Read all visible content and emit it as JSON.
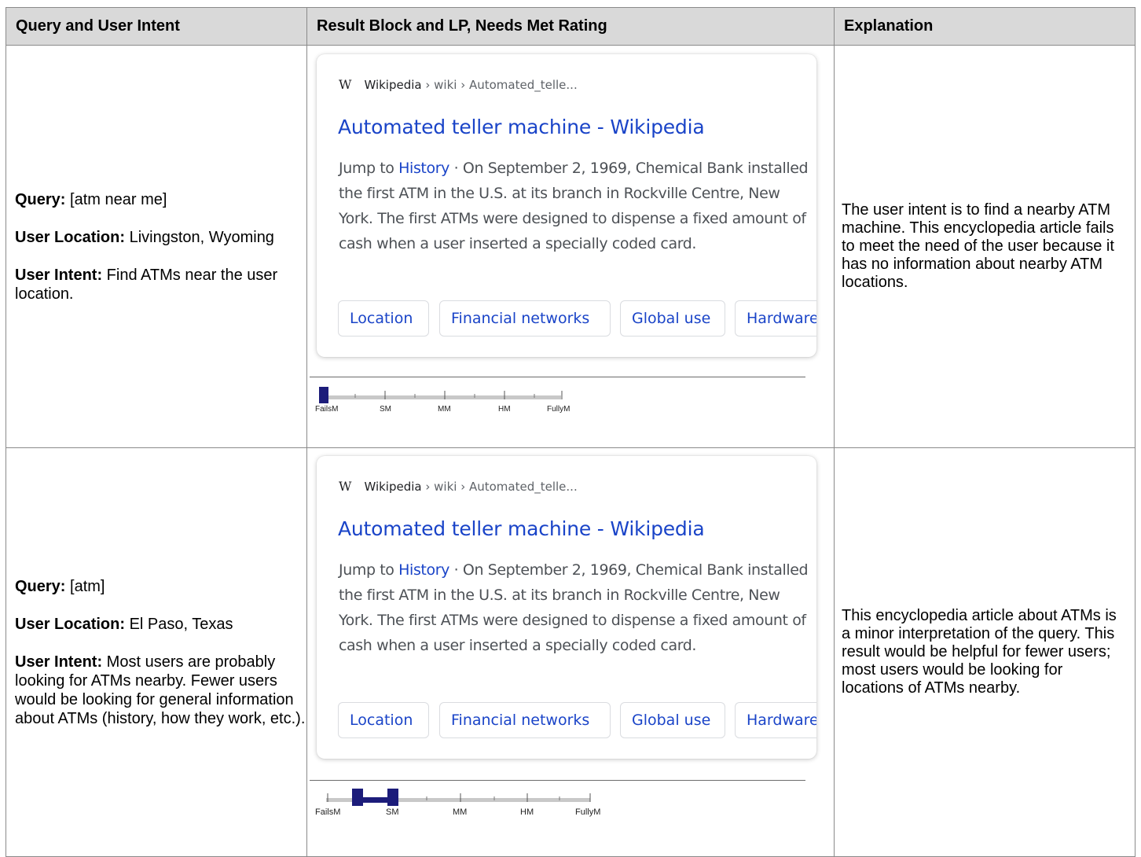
{
  "headers": {
    "query": "Query and User Intent",
    "result": "Result Block and LP, Needs Met Rating",
    "explanation": "Explanation"
  },
  "rows": [
    {
      "query_label": "Query:",
      "query_value": " [atm near me]",
      "location_label": "User Location:",
      "location_value": " Livingston, Wyoming",
      "intent_label": "User Intent:",
      "intent_value": " Find ATMs near the user location.",
      "result": {
        "logo": "W",
        "source": "Wikipedia",
        "path": " › wiki › Automated_telle...",
        "title": "Automated teller machine - Wikipedia",
        "snippet_prefix": "Jump to ",
        "snippet_link": "History",
        "snippet_text": " · On September 2, 1969, Chemical Bank installed the first ATM in the U.S. at its branch in Rockville Centre, New York. The first ATMs were designed to dispense a fixed amount of cash when a user inserted a specially coded card.",
        "chips": [
          "Location",
          "Financial networks",
          "Global use",
          "Hardware"
        ]
      },
      "rating": {
        "labels": [
          "FailsM",
          "SM",
          "MM",
          "HM",
          "FullyM"
        ],
        "value": "FailsM",
        "range": [
          0,
          0
        ]
      },
      "explanation": "The user intent is to find a nearby ATM machine.  This encyclopedia article fails to meet the need of the user because it has no information about nearby ATM locations."
    },
    {
      "query_label": "Query:",
      "query_value": " [atm]",
      "location_label": "User Location:",
      "location_value": " El Paso, Texas",
      "intent_label": "User Intent:",
      "intent_value": " Most users are probably looking for ATMs nearby.  Fewer users would be looking for general information about ATMs (history, how they work, etc.).",
      "result": {
        "logo": "W",
        "source": "Wikipedia",
        "path": " › wiki › Automated_telle...",
        "title": "Automated teller machine - Wikipedia",
        "snippet_prefix": "Jump to ",
        "snippet_link": "History",
        "snippet_text": " · On September 2, 1969, Chemical Bank installed the first ATM in the U.S. at its branch in Rockville Centre, New York. The first ATMs were designed to dispense a fixed amount of cash when a user inserted a specially coded card.",
        "chips": [
          "Location",
          "Financial networks",
          "Global use",
          "Hardware"
        ]
      },
      "rating": {
        "labels": [
          "FailsM",
          "SM",
          "MM",
          "HM",
          "FullyM"
        ],
        "value": "FailsM+ to SM",
        "range": [
          0.5,
          1
        ]
      },
      "explanation": "This encyclopedia article about ATMs is a minor interpretation of the query.  This result would be helpful for fewer users; most users would be looking for locations of ATMs nearby."
    }
  ],
  "colors": {
    "link": "#1a44c8",
    "rating_bar": "#1c1c7a",
    "track": "#c8c8c8",
    "header_bg": "#d9d9d9"
  }
}
